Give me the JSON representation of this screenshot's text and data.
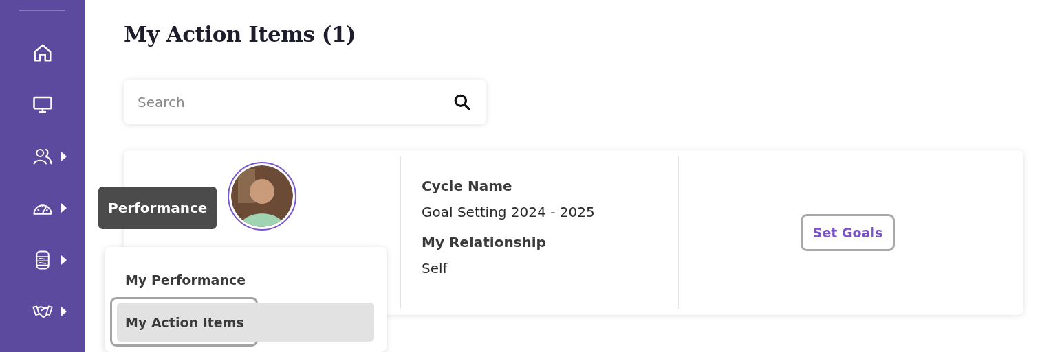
{
  "sidebar": {
    "items": [
      {
        "kind": "home",
        "has_submenu": false
      },
      {
        "kind": "monitor",
        "has_submenu": false
      },
      {
        "kind": "people",
        "has_submenu": true
      },
      {
        "kind": "gauge",
        "has_submenu": true
      },
      {
        "kind": "database",
        "has_submenu": true
      },
      {
        "kind": "handshake",
        "has_submenu": true
      }
    ]
  },
  "tooltip": "Performance",
  "submenu": {
    "items": [
      {
        "label": "My Performance",
        "selected": false
      },
      {
        "label": "My Action Items",
        "selected": true
      }
    ]
  },
  "page_title": "My Action Items (1)",
  "search": {
    "placeholder": "Search"
  },
  "card": {
    "fields": [
      {
        "label": "Cycle Name",
        "value": "Goal Setting 2024 - 2025"
      },
      {
        "label": "My Relationship",
        "value": "Self"
      }
    ],
    "action": "Set Goals"
  }
}
